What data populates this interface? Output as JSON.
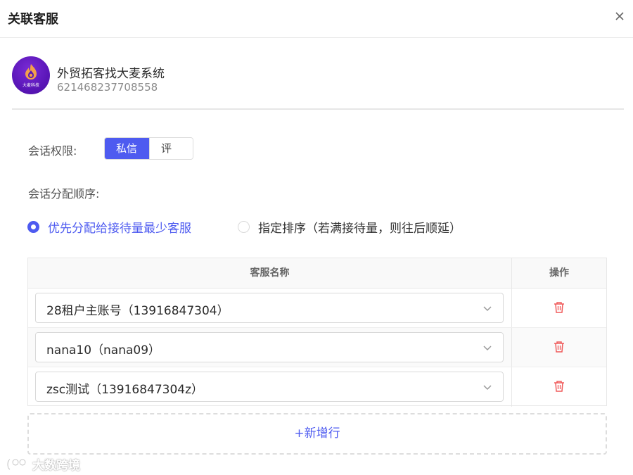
{
  "dialog": {
    "title": "关联客服",
    "close_icon": "close-icon"
  },
  "account": {
    "name": "外贸拓客找大麦系统",
    "id": "621468237708558",
    "avatar_text": "大麦科技",
    "avatar_color": "#5a16b8"
  },
  "permission": {
    "label": "会话权限:",
    "options": [
      "私信",
      "评论"
    ],
    "selected": "私信"
  },
  "order": {
    "label": "会话分配顺序:",
    "options": [
      "优先分配给接待量最少客服",
      "指定排序（若满接待量，则往后顺延）"
    ],
    "selected": "优先分配给接待量最少客服"
  },
  "table": {
    "columns": [
      "客服名称",
      "操作"
    ],
    "rows": [
      {
        "agent": "28租户主账号（13916847304）"
      },
      {
        "agent": "nana10（nana09）"
      },
      {
        "agent": "zsc测试（13916847304z）"
      }
    ]
  },
  "add_row_label": "+新增行",
  "watermark": "大数跨境",
  "colors": {
    "accent": "#4e5bf0",
    "danger": "#f05a5a",
    "border": "#e8e8e8"
  }
}
